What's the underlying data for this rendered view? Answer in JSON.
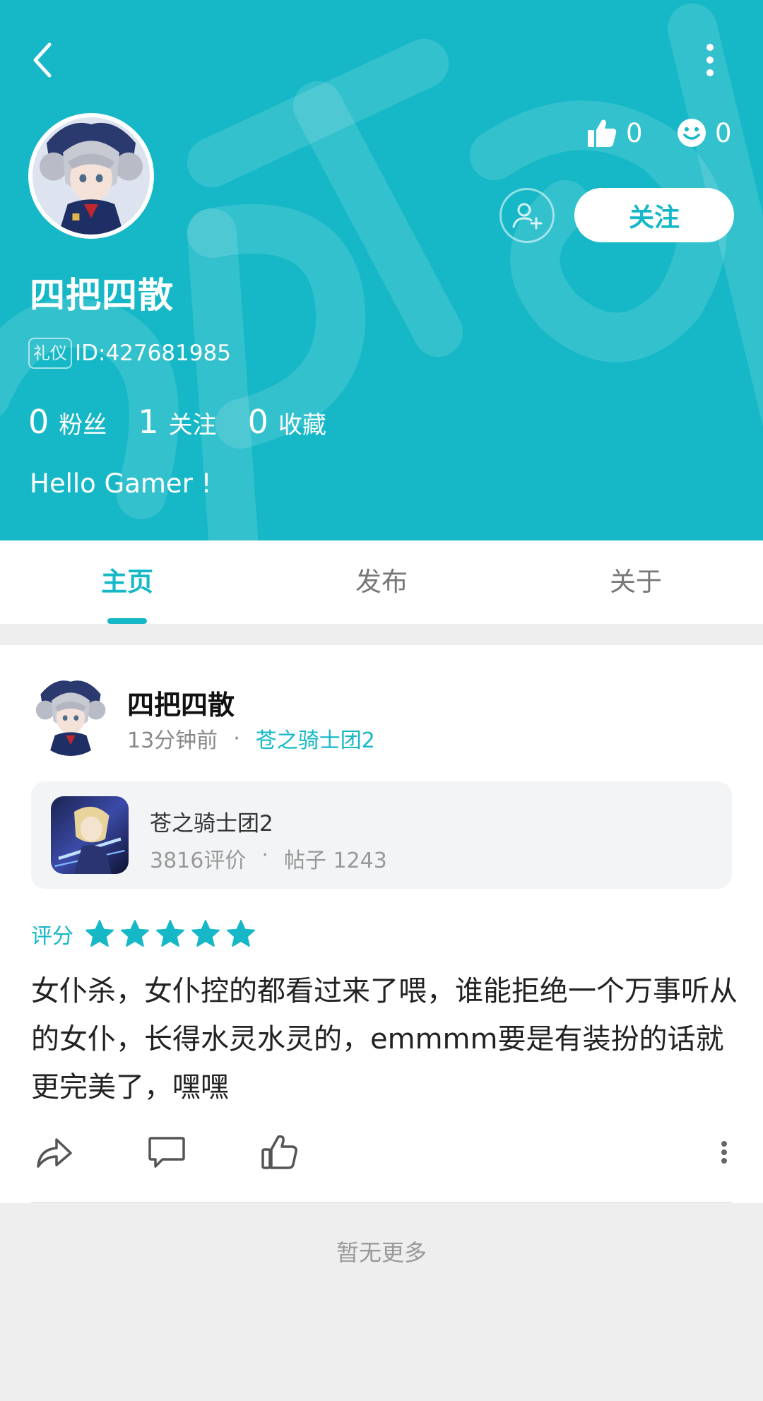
{
  "colors": {
    "accent": "#16b8c7",
    "background": "#eeeeee"
  },
  "header": {
    "likes_count": "0",
    "smile_count": "0",
    "follow_label": "关注",
    "username": "四把四散",
    "tag_badge": "礼仪",
    "user_id": "ID:427681985",
    "stats": [
      {
        "value": "0",
        "label": "粉丝"
      },
      {
        "value": "1",
        "label": "关注"
      },
      {
        "value": "0",
        "label": "收藏"
      }
    ],
    "bio": "Hello Gamer !"
  },
  "tabs": [
    {
      "label": "主页",
      "active": true
    },
    {
      "label": "发布",
      "active": false
    },
    {
      "label": "关于",
      "active": false
    }
  ],
  "post": {
    "author": "四把四散",
    "time": "13分钟前",
    "dot": "·",
    "game_link": "苍之骑士团2",
    "game": {
      "name": "苍之骑士团2",
      "reviews": "3816评价",
      "posts": "帖子 1243"
    },
    "rating_label": "评分",
    "rating_stars": 5,
    "text": "女仆杀，女仆控的都看过来了喂，谁能拒绝一个万事听从的女仆，长得水灵水灵的，emmmm要是有装扮的话就更完美了，嘿嘿"
  },
  "footer": {
    "no_more": "暂无更多"
  }
}
